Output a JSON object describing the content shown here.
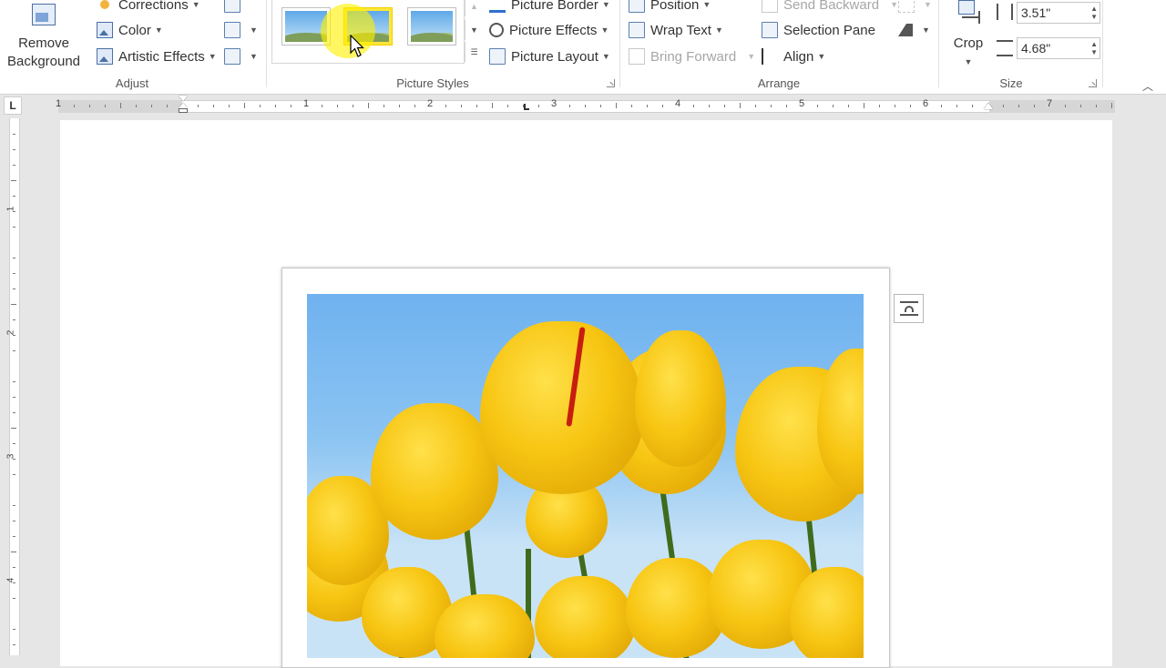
{
  "ribbon": {
    "adjust": {
      "remove_background_line1": "Remove",
      "remove_background_line2": "Background",
      "corrections": "Corrections",
      "color": "Color",
      "artistic_effects": "Artistic Effects",
      "group_label": "Adjust"
    },
    "picture_styles": {
      "picture_border": "Picture Border",
      "picture_effects": "Picture Effects",
      "picture_layout": "Picture Layout",
      "group_label": "Picture Styles"
    },
    "arrange": {
      "position": "Position",
      "wrap_text": "Wrap Text",
      "bring_forward": "Bring Forward",
      "send_backward": "Send Backward",
      "selection_pane": "Selection Pane",
      "align": "Align",
      "group_label": "Arrange"
    },
    "size": {
      "crop": "Crop",
      "height": "3.51\"",
      "width": "4.68\"",
      "group_label": "Size"
    }
  },
  "ruler": {
    "tab_selector": "L",
    "h_numbers": [
      "1",
      "1",
      "2",
      "3",
      "4",
      "5",
      "6",
      "7"
    ],
    "v_numbers": [
      "1",
      "2",
      "3",
      "4"
    ]
  },
  "colors": {
    "highlight": "#fff000",
    "tulip": "#f7c512",
    "sky": "#6fb2f0"
  }
}
